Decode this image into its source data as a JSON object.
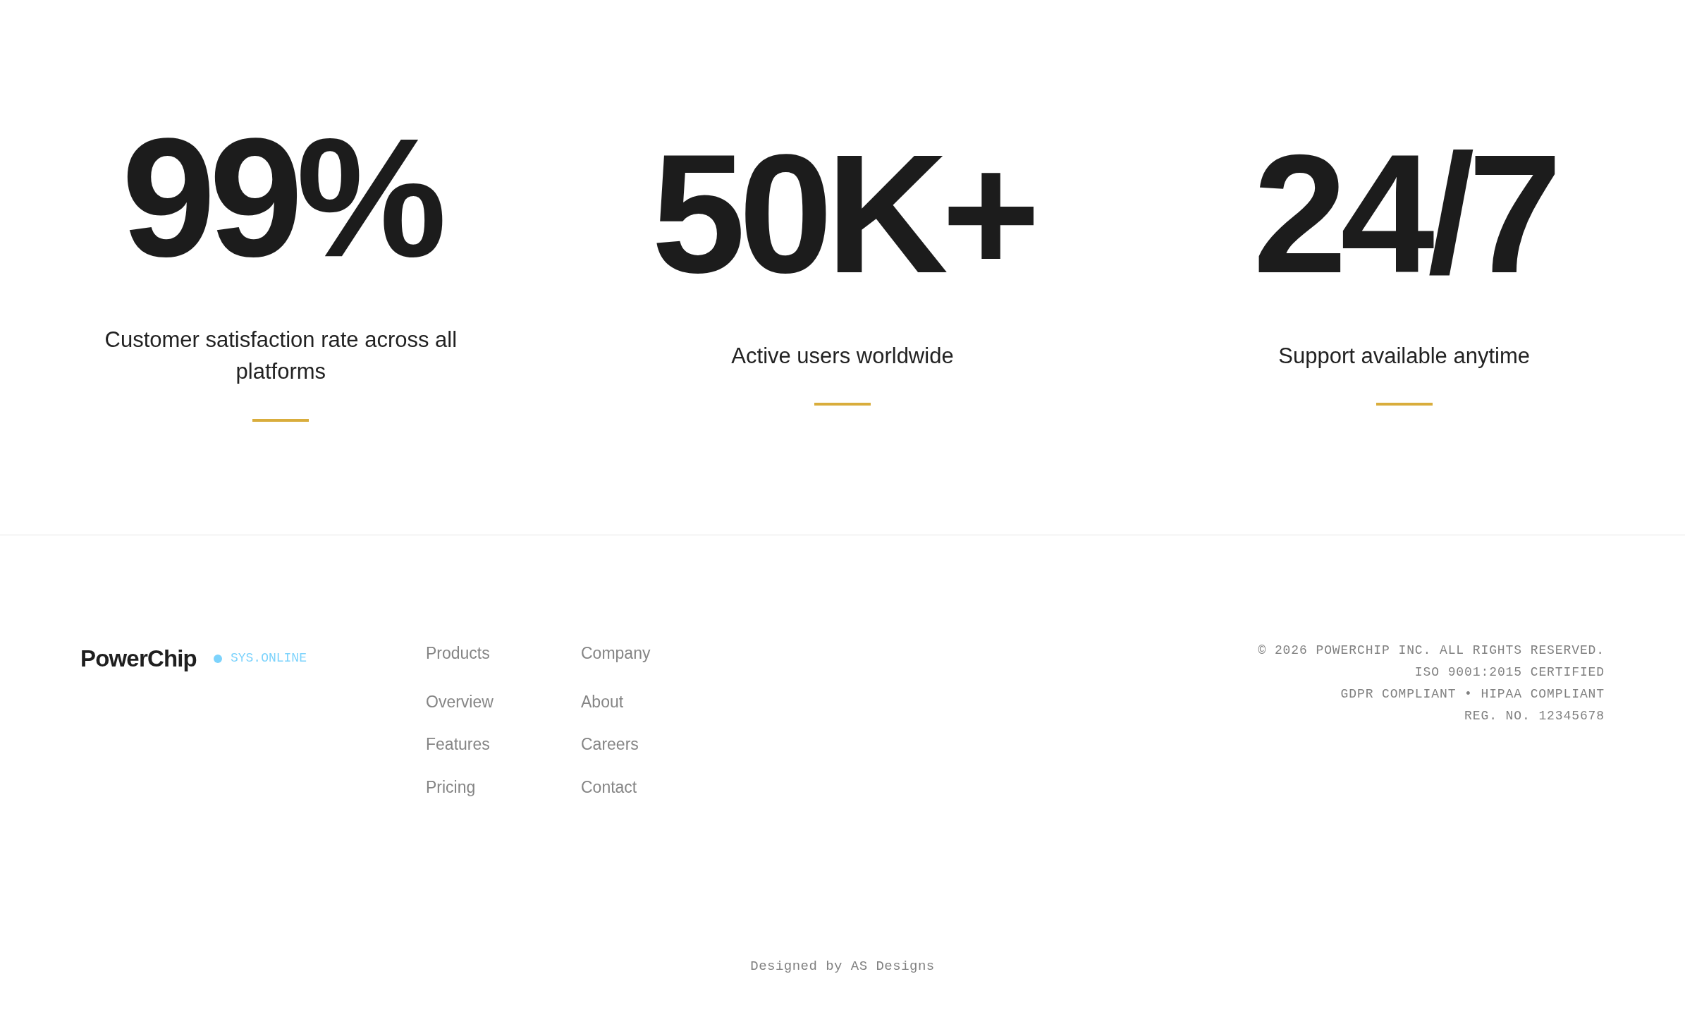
{
  "stats": [
    {
      "value": "99%",
      "caption": "Customer satisfaction rate across all platforms"
    },
    {
      "value": "50K+",
      "caption": "Active users worldwide"
    },
    {
      "value": "24/7",
      "caption": "Support available anytime"
    }
  ],
  "footer": {
    "brand": "PowerChip",
    "status": {
      "label": "SYS.ONLINE",
      "color": "#7dd3fc"
    },
    "columns": [
      {
        "heading": "Products",
        "links": [
          "Overview",
          "Features",
          "Pricing"
        ]
      },
      {
        "heading": "Company",
        "links": [
          "About",
          "Careers",
          "Contact"
        ]
      }
    ],
    "legal": [
      "© 2026 POWERCHIP INC. ALL RIGHTS RESERVED.",
      "ISO 9001:2015 CERTIFIED",
      "GDPR COMPLIANT • HIPAA COMPLIANT",
      "REG. NO. 12345678"
    ],
    "credit": "Designed by AS Designs"
  }
}
